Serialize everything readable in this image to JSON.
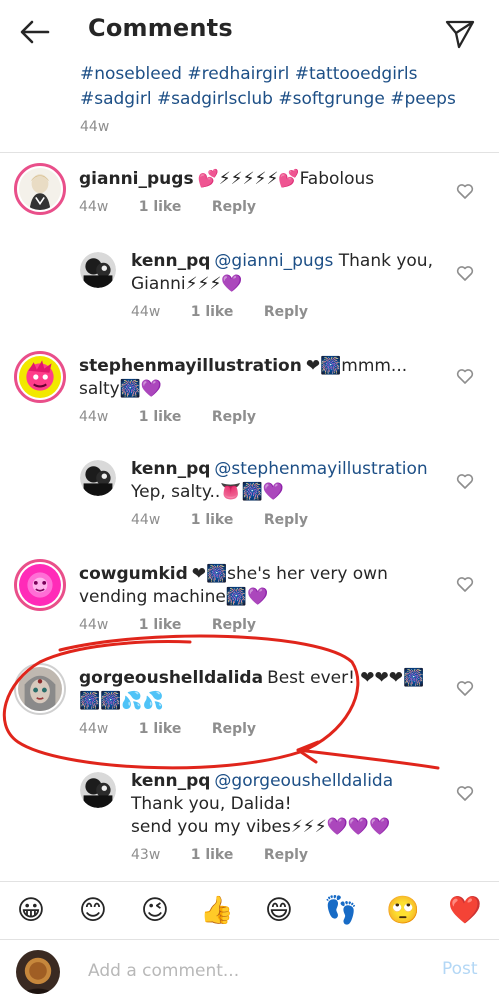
{
  "header": {
    "title": "Comments",
    "back_icon": "arrow-left-icon",
    "send_icon": "paper-plane-icon"
  },
  "caption": {
    "text": "#nosebleed #redhairgirl #tattooedgirls #sadgirl #sadgirlsclub #softgrunge #peeps",
    "time": "44w"
  },
  "comments": [
    {
      "username": "gianni_pugs",
      "text": "💕⚡⚡⚡⚡⚡💕Fabolous",
      "time": "44w",
      "likes": "1 like",
      "reply": "Reply"
    },
    {
      "username": "kenn_pq",
      "mention": "@gianni_pugs",
      "text": " Thank you, Gianni⚡⚡⚡💜",
      "time": "44w",
      "likes": "1 like",
      "reply": "Reply"
    },
    {
      "username": "stephenmayillustration",
      "text": "❤🎆mmm... salty🎆💜",
      "time": "44w",
      "likes": "1 like",
      "reply": "Reply"
    },
    {
      "username": "kenn_pq",
      "mention": "@stephenmayillustration",
      "text": "Yep, salty..👅🎆💜",
      "time": "44w",
      "likes": "1 like",
      "reply": "Reply"
    },
    {
      "username": "cowgumkid",
      "text": "❤🎆she's her very own vending machine🎆💜",
      "time": "44w",
      "likes": "1 like",
      "reply": "Reply"
    },
    {
      "username": "gorgeoushelldalida",
      "text": "Best ever! ❤❤❤🎆🎆🎆💦💦",
      "time": "44w",
      "likes": "1 like",
      "reply": "Reply"
    },
    {
      "username": "kenn_pq",
      "mention": "@gorgeoushelldalida",
      "text": " Thank you, Dalida!",
      "text2": "send you my vibes⚡⚡⚡💜💜💜",
      "time": "43w",
      "likes": "1 like",
      "reply": "Reply"
    }
  ],
  "emoji_bar": [
    "😀",
    "😊",
    "😉",
    "👍",
    "😄",
    "👣",
    "🙄",
    "❤️"
  ],
  "composer": {
    "placeholder": "Add a comment...",
    "post_label": "Post"
  },
  "colors": {
    "link": "#1d4f86",
    "meta": "#8e8e8e",
    "post_disabled": "#b3d7f5",
    "annotation_red": "#e0251b"
  }
}
